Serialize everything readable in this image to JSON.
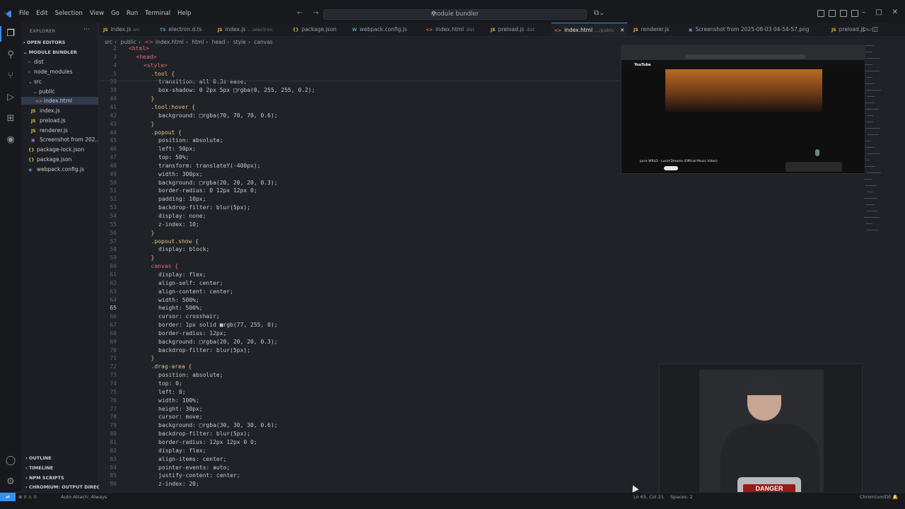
{
  "menu": {
    "file": "File",
    "edit": "Edit",
    "selection": "Selection",
    "view": "View",
    "go": "Go",
    "run": "Run",
    "terminal": "Terminal",
    "help": "Help"
  },
  "command_center": {
    "label": "module bundler"
  },
  "sidebar": {
    "title": "EXPLORER",
    "open_editors": "OPEN EDITORS",
    "project": "MODULE BUNDLER",
    "tree": [
      {
        "label": "dist",
        "icon": "folder-closed-icon"
      },
      {
        "label": "node_modules",
        "icon": "folder-closed-icon"
      },
      {
        "label": "src",
        "icon": "folder-open-icon"
      },
      {
        "label": "public",
        "icon": "folder-open-icon"
      },
      {
        "label": "index.html",
        "icon": "html-file-icon"
      },
      {
        "label": "index.js",
        "icon": "js-file-icon"
      },
      {
        "label": "preload.js",
        "icon": "js-file-icon"
      },
      {
        "label": "renderer.js",
        "icon": "js-file-icon"
      },
      {
        "label": "Screenshot from 202...",
        "icon": "image-file-icon"
      },
      {
        "label": "package-lock.json",
        "icon": "json-file-icon"
      },
      {
        "label": "package.json",
        "icon": "json-file-icon"
      },
      {
        "label": "webpack.config.js",
        "icon": "config-file-icon"
      }
    ],
    "bottom": [
      {
        "label": "OUTLINE"
      },
      {
        "label": "TIMELINE"
      },
      {
        "label": "NPM SCRIPTS"
      },
      {
        "label": "CHROMIUM: OUTPUT DIRECT..."
      }
    ]
  },
  "tabs": [
    {
      "icon": "JS",
      "label": "index.js",
      "hint": "src"
    },
    {
      "icon": "TS",
      "label": "electron.d.ts",
      "hint": ""
    },
    {
      "icon": "JS",
      "label": "index.js",
      "hint": "...\\electron"
    },
    {
      "icon": "{}",
      "label": "package.json",
      "hint": ""
    },
    {
      "icon": "W",
      "label": "webpack.config.js",
      "hint": ""
    },
    {
      "icon": "<>",
      "label": "index.html",
      "hint": "dist"
    },
    {
      "icon": "JS",
      "label": "preload.js",
      "hint": "dist"
    },
    {
      "icon": "<>",
      "label": "index.html",
      "hint": ".../public"
    },
    {
      "icon": "JS",
      "label": "renderer.js",
      "hint": ""
    },
    {
      "icon": "▣",
      "label": "Screenshot from 2025-08-03 04-54-57.png",
      "hint": ""
    },
    {
      "icon": "JS",
      "label": "preload.js",
      "hint": "src"
    }
  ],
  "breadcrumb": [
    "src",
    "›",
    "public",
    "›",
    "index.html",
    "›",
    "html",
    "›",
    "head",
    "›",
    "style",
    "›",
    "canvas"
  ],
  "code": [
    {
      "n": "2",
      "text": "<html>",
      "cls": "t-tag",
      "indent": 0
    },
    {
      "n": "3",
      "text": "<head>",
      "cls": "t-tag",
      "indent": 1
    },
    {
      "n": "4",
      "text": "<style>",
      "cls": "t-tag",
      "indent": 2
    },
    {
      "n": "5",
      "text": ".tool {",
      "cls": "t-sel",
      "indent": 3
    },
    {
      "n": "38",
      "text": "transition: all 0.3s ease;",
      "cls": "t-prop",
      "indent": 4
    },
    {
      "n": "39",
      "text": "box-shadow: 0 2px 5px □rgba(0, 255, 255, 0.2);",
      "cls": "t-prop",
      "indent": 4
    },
    {
      "n": "40",
      "text": "}",
      "cls": "t-sel",
      "indent": 3
    },
    {
      "n": "41",
      "text": ".tool:hover {",
      "cls": "t-sel",
      "indent": 3
    },
    {
      "n": "42",
      "text": "background: □rgba(70, 70, 70, 0.6);",
      "cls": "t-prop",
      "indent": 4
    },
    {
      "n": "43",
      "text": "}",
      "cls": "t-sel",
      "indent": 3
    },
    {
      "n": "44",
      "text": ".popout {",
      "cls": "t-sel",
      "indent": 3
    },
    {
      "n": "45",
      "text": "position: absolute;",
      "cls": "t-prop",
      "indent": 4
    },
    {
      "n": "46",
      "text": "left: 50px;",
      "cls": "t-prop",
      "indent": 4
    },
    {
      "n": "47",
      "text": "top: 50%;",
      "cls": "t-prop",
      "indent": 4
    },
    {
      "n": "48",
      "text": "transform: translateY(-400px);",
      "cls": "t-prop",
      "indent": 4
    },
    {
      "n": "49",
      "text": "width: 300px;",
      "cls": "t-prop",
      "indent": 4
    },
    {
      "n": "50",
      "text": "background: □rgba(20, 20, 20, 0.3);",
      "cls": "t-prop",
      "indent": 4
    },
    {
      "n": "51",
      "text": "border-radius: 0 12px 12px 0;",
      "cls": "t-prop",
      "indent": 4
    },
    {
      "n": "52",
      "text": "padding: 10px;",
      "cls": "t-prop",
      "indent": 4
    },
    {
      "n": "53",
      "text": "backdrop-filter: blur(5px);",
      "cls": "t-prop",
      "indent": 4
    },
    {
      "n": "54",
      "text": "display: none;",
      "cls": "t-prop",
      "indent": 4
    },
    {
      "n": "55",
      "text": "z-index: 10;",
      "cls": "t-prop",
      "indent": 4
    },
    {
      "n": "56",
      "text": "}",
      "cls": "t-sel",
      "indent": 3
    },
    {
      "n": "57",
      "text": ".popout.show {",
      "cls": "t-sel",
      "indent": 3
    },
    {
      "n": "58",
      "text": "display: block;",
      "cls": "t-prop",
      "indent": 4
    },
    {
      "n": "59",
      "text": "}",
      "cls": "t-sel",
      "indent": 3
    },
    {
      "n": "60",
      "text": "canvas {",
      "cls": "t-tag",
      "indent": 3
    },
    {
      "n": "61",
      "text": "display: flex;",
      "cls": "t-prop",
      "indent": 4
    },
    {
      "n": "62",
      "text": "align-self: center;",
      "cls": "t-prop",
      "indent": 4
    },
    {
      "n": "63",
      "text": "align-content: center;",
      "cls": "t-prop",
      "indent": 4
    },
    {
      "n": "64",
      "text": "width: 500%;",
      "cls": "t-prop",
      "indent": 4
    },
    {
      "n": "65",
      "text": "height: 500%;",
      "cls": "t-prop",
      "indent": 4
    },
    {
      "n": "66",
      "text": "cursor: crosshair;",
      "cls": "t-prop",
      "indent": 4
    },
    {
      "n": "67",
      "text": "border: 1px solid ■rgb(77, 255, 0);",
      "cls": "t-prop",
      "indent": 4
    },
    {
      "n": "68",
      "text": "border-radius: 12px;",
      "cls": "t-prop",
      "indent": 4
    },
    {
      "n": "69",
      "text": "background: □rgba(20, 20, 20, 0.3);",
      "cls": "t-prop",
      "indent": 4
    },
    {
      "n": "70",
      "text": "backdrop-filter: blur(5px);",
      "cls": "t-prop",
      "indent": 4
    },
    {
      "n": "71",
      "text": "}",
      "cls": "t-sel",
      "indent": 3
    },
    {
      "n": "72",
      "text": ".drag-area {",
      "cls": "t-sel",
      "indent": 3
    },
    {
      "n": "73",
      "text": "position: absolute;",
      "cls": "t-prop",
      "indent": 4
    },
    {
      "n": "74",
      "text": "top: 0;",
      "cls": "t-prop",
      "indent": 4
    },
    {
      "n": "75",
      "text": "left: 0;",
      "cls": "t-prop",
      "indent": 4
    },
    {
      "n": "76",
      "text": "width: 100%;",
      "cls": "t-prop",
      "indent": 4
    },
    {
      "n": "77",
      "text": "height: 30px;",
      "cls": "t-prop",
      "indent": 4
    },
    {
      "n": "78",
      "text": "cursor: move;",
      "cls": "t-prop",
      "indent": 4
    },
    {
      "n": "79",
      "text": "background: □rgba(30, 30, 30, 0.6);",
      "cls": "t-prop",
      "indent": 4
    },
    {
      "n": "80",
      "text": "backdrop-filter: blur(5px);",
      "cls": "t-prop",
      "indent": 4
    },
    {
      "n": "81",
      "text": "border-radius: 12px 12px 0 0;",
      "cls": "t-prop",
      "indent": 4
    },
    {
      "n": "82",
      "text": "display: flex;",
      "cls": "t-prop",
      "indent": 4
    },
    {
      "n": "83",
      "text": "align-items: center;",
      "cls": "t-prop",
      "indent": 4
    },
    {
      "n": "84",
      "text": "pointer-events: auto;",
      "cls": "t-prop",
      "indent": 4
    },
    {
      "n": "85",
      "text": "justify-content: center;",
      "cls": "t-prop",
      "indent": 4
    },
    {
      "n": "86",
      "text": "z-index: 20;",
      "cls": "t-prop",
      "indent": 4
    }
  ],
  "current_line": "65",
  "preview": {
    "logo": "YouTube",
    "title": "Juice WRLD - Lucid Dreams (Official Music Video)"
  },
  "webcam": {
    "shirt_text": "DANGER"
  },
  "status": {
    "errors": "⊗ 0 ⚠ 0",
    "auto_attach": "Auto Attach: Always",
    "position": "Ln 65, Col 21",
    "spaces": "Spaces: 2",
    "chromium": "ChromiumIDE"
  },
  "colors": {
    "accent": "#3b8eea",
    "editor_bg": "#1f2227",
    "sidebar_bg": "#1d1f24"
  }
}
